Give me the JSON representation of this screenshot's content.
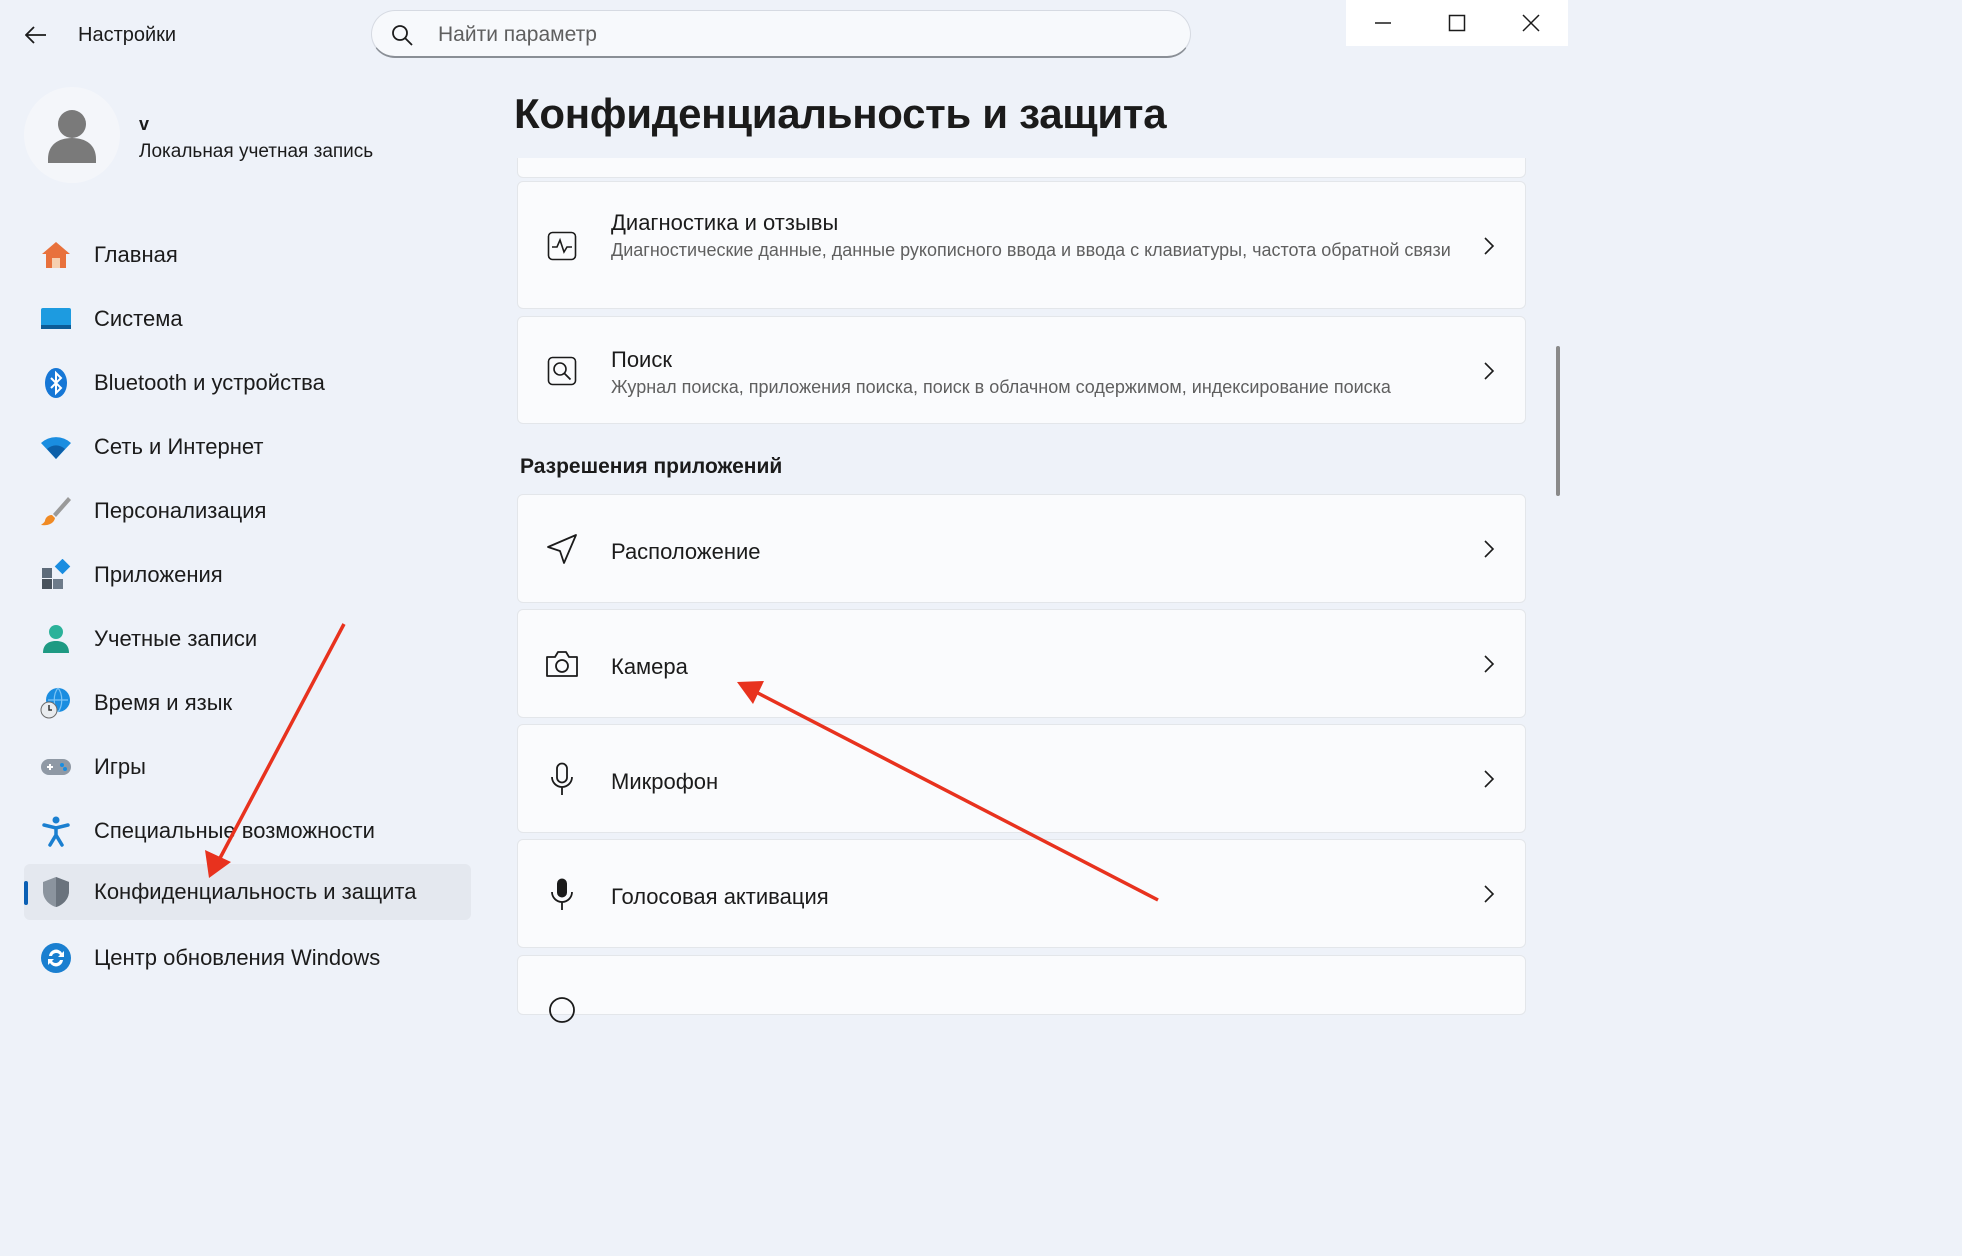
{
  "window": {
    "title": "Настройки",
    "controls": [
      "minimize-icon",
      "maximize-icon",
      "close-icon"
    ]
  },
  "search": {
    "placeholder": "Найти параметр",
    "value": ""
  },
  "profile": {
    "name": "v",
    "account_type": "Локальная учетная запись"
  },
  "sidebar": {
    "items": [
      {
        "label": "Главная",
        "icon": "home-icon"
      },
      {
        "label": "Система",
        "icon": "system-display-icon"
      },
      {
        "label": "Bluetooth и устройства",
        "icon": "bluetooth-icon"
      },
      {
        "label": "Сеть и Интернет",
        "icon": "wifi-icon"
      },
      {
        "label": "Персонализация",
        "icon": "brush-icon"
      },
      {
        "label": "Приложения",
        "icon": "apps-icon"
      },
      {
        "label": "Учетные записи",
        "icon": "accounts-icon"
      },
      {
        "label": "Время и язык",
        "icon": "globe-clock-icon"
      },
      {
        "label": "Игры",
        "icon": "gamepad-icon"
      },
      {
        "label": "Специальные возможности",
        "icon": "accessibility-icon"
      },
      {
        "label": "Конфиденциальность и защита",
        "icon": "shield-icon",
        "active": true
      },
      {
        "label": "Центр обновления Windows",
        "icon": "windows-update-icon"
      }
    ]
  },
  "main": {
    "title": "Конфиденциальность и защита",
    "cards_top": [
      {
        "title": "Диагностика и отзывы",
        "description": "Диагностические данные, данные рукописного ввода и ввода с клавиатуры, частота обратной связи",
        "icon": "diagnostics-icon"
      },
      {
        "title": "Поиск",
        "description": "Журнал поиска, приложения поиска, поиск в облачном содержимом, индексирование поиска",
        "icon": "search-permissions-icon"
      }
    ],
    "section_title": "Разрешения приложений",
    "permissions": [
      {
        "title": "Расположение",
        "icon": "location-icon"
      },
      {
        "title": "Камера",
        "icon": "camera-icon"
      },
      {
        "title": "Микрофон",
        "icon": "microphone-icon"
      },
      {
        "title": "Голосовая активация",
        "icon": "voice-activation-icon"
      }
    ]
  },
  "colors": {
    "background": "#eef2f9",
    "accent": "#0a5fb4",
    "annotation_arrow": "#e8321e"
  }
}
